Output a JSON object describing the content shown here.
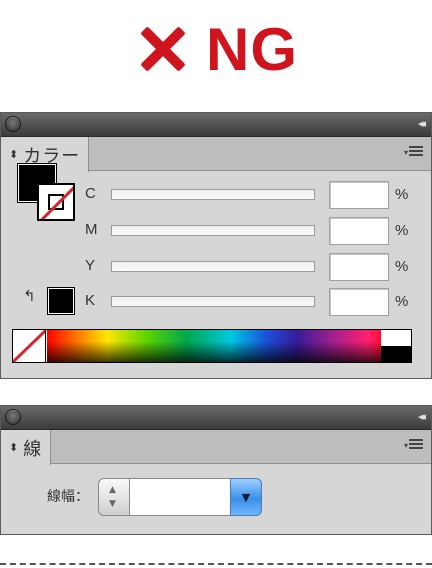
{
  "header": {
    "ng_text": "NG",
    "ng_color": "#d0141d",
    "ng_icon": "cross-icon"
  },
  "color_panel": {
    "tab_label": "カラー",
    "tab_arrow": "⬍",
    "cmyk": [
      {
        "label": "C",
        "value": "",
        "unit": "%"
      },
      {
        "label": "M",
        "value": "",
        "unit": "%"
      },
      {
        "label": "Y",
        "value": "",
        "unit": "%"
      },
      {
        "label": "K",
        "value": "",
        "unit": "%"
      }
    ],
    "last_color_icon": "return-arrow-icon",
    "last_color_glyph": "↰",
    "fill_color": "#000000",
    "stroke_state": "none",
    "none_color": "#d9262c"
  },
  "stroke_panel": {
    "tab_label": "線",
    "tab_arrow": "⬍",
    "weight_label": "線幅：",
    "weight_value": "",
    "stepper_up": "▲",
    "stepper_down": "▼",
    "dropdown_glyph": "▼"
  },
  "panel": {
    "collapse_glyph": "◂◂",
    "menu_tri": "▾"
  }
}
